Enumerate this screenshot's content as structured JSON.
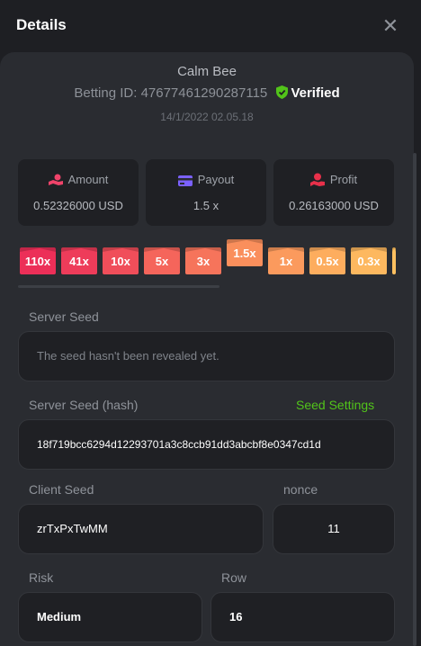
{
  "modal": {
    "title": "Details"
  },
  "bet": {
    "player_name": "Calm Bee",
    "betting_id_label": "Betting ID:",
    "betting_id": "47677461290287115",
    "verified_label": "Verified",
    "datetime": "14/1/2022 02.05.18"
  },
  "stats": {
    "amount_label": "Amount",
    "amount_value": "0.52326000 USD",
    "payout_label": "Payout",
    "payout_value": "1.5 x",
    "profit_label": "Profit",
    "profit_value": "0.26163000 USD"
  },
  "multipliers": [
    {
      "label": "110x",
      "color": "#ec2f58"
    },
    {
      "label": "41x",
      "color": "#ee3c5a"
    },
    {
      "label": "10x",
      "color": "#f04e5a"
    },
    {
      "label": "5x",
      "color": "#f5655b"
    },
    {
      "label": "3x",
      "color": "#f6745b"
    },
    {
      "label": "1.5x",
      "color": "#fa8f5c",
      "active": true
    },
    {
      "label": "1x",
      "color": "#fb9a5d"
    },
    {
      "label": "0.5x",
      "color": "#fdad5e"
    },
    {
      "label": "0.3x",
      "color": "#fdb85f"
    }
  ],
  "seeds": {
    "server_seed_label": "Server Seed",
    "server_seed_value": "The seed hasn't been revealed yet.",
    "server_hash_label": "Server Seed (hash)",
    "seed_settings_link": "Seed Settings",
    "server_hash_value": "18f719bcc6294d12293701a3c8ccb91dd3abcbf8e0347cd1d",
    "client_seed_label": "Client Seed",
    "client_seed_value": "zrTxPxTwMM",
    "nonce_label": "nonce",
    "nonce_value": "11"
  },
  "game": {
    "risk_label": "Risk",
    "risk_value": "Medium",
    "row_label": "Row",
    "row_value": "16"
  },
  "colors": {
    "accent_green": "#52c41a",
    "amount_icon": "#f0436a",
    "payout_icon": "#7b61ff",
    "profit_icon": "#e8304a"
  }
}
